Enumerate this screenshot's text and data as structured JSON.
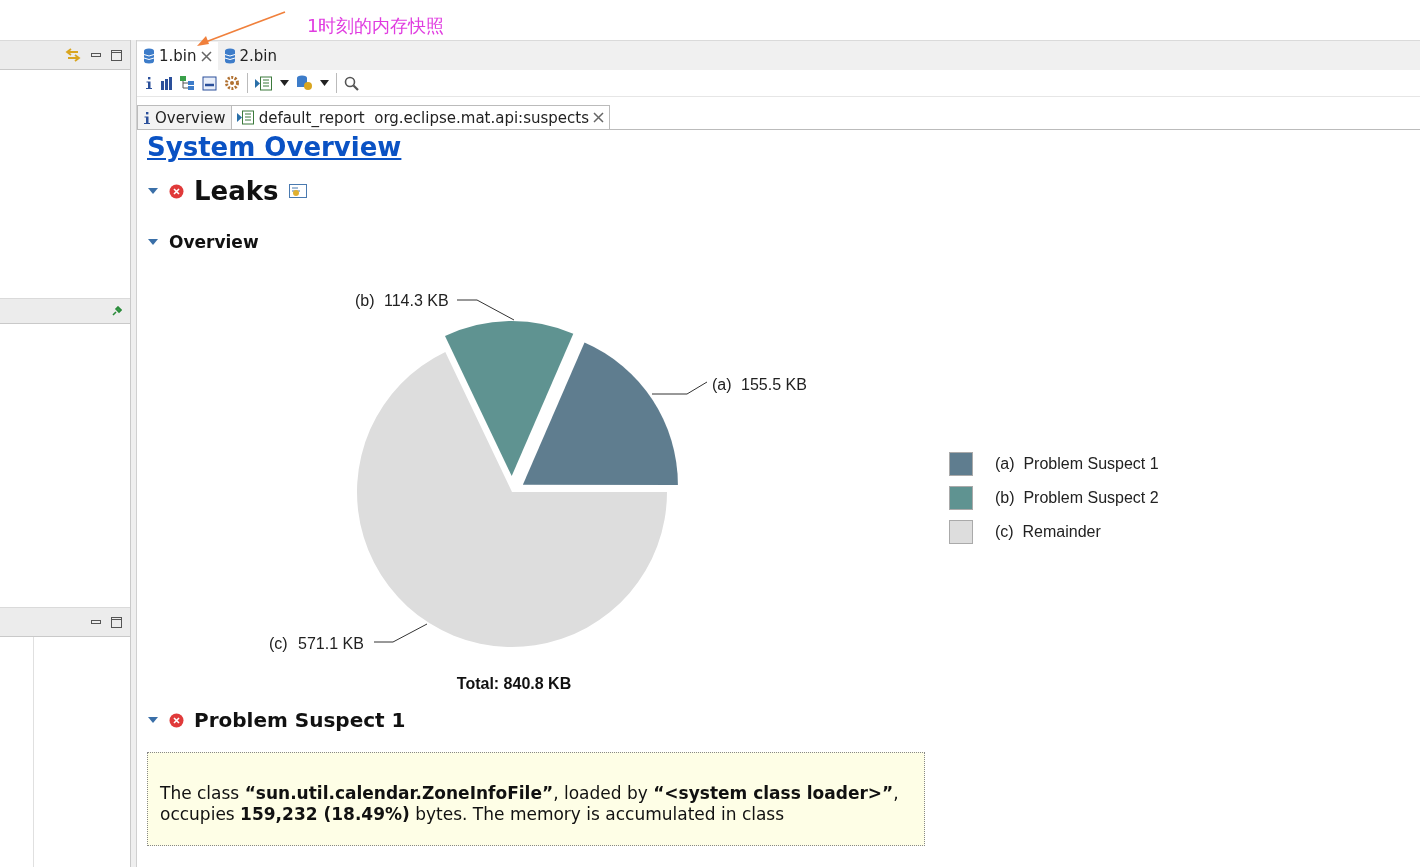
{
  "annotation": {
    "text": "1时刻的内存快照"
  },
  "editor_tabs": [
    {
      "label": "1.bin",
      "selected": true,
      "closable": true
    },
    {
      "label": "2.bin",
      "selected": false,
      "closable": false
    }
  ],
  "report_tabs": [
    {
      "label": "Overview",
      "kind": "info",
      "selected": false,
      "closable": false
    },
    {
      "label": "default_report  org.eclipse.mat.api:suspects",
      "kind": "report",
      "selected": true,
      "closable": true
    }
  ],
  "page_title": "System Overview",
  "sections": [
    {
      "title": "Leaks",
      "expanded": true
    },
    {
      "title": "Overview",
      "expanded": true
    }
  ],
  "chart_data": {
    "type": "pie",
    "categories": [
      "(a)",
      "(b)",
      "(c)"
    ],
    "values": [
      155.5,
      114.3,
      571.1
    ],
    "colors": [
      "#5f7d8f",
      "#5f9391",
      "#dddddd"
    ],
    "value_labels": [
      "155.5 KB",
      "114.3 KB",
      "571.1 KB"
    ]
  },
  "legend": [
    {
      "label": "(a)  Problem Suspect 1",
      "color": "#5f7d8f"
    },
    {
      "label": "(b)  Problem Suspect 2",
      "color": "#5f9391"
    },
    {
      "label": "(c)  Remainder",
      "color": "#dddddd"
    }
  ],
  "total": "Total: 840.8 KB",
  "suspect": {
    "title": "Problem Suspect 1",
    "expanded": true,
    "text": "The class **“sun.util.calendar.ZoneInfoFile”**, loaded by **“<system class loader>”**, occupies **159,232 (18.49%)** bytes. The memory is accumulated in class"
  }
}
